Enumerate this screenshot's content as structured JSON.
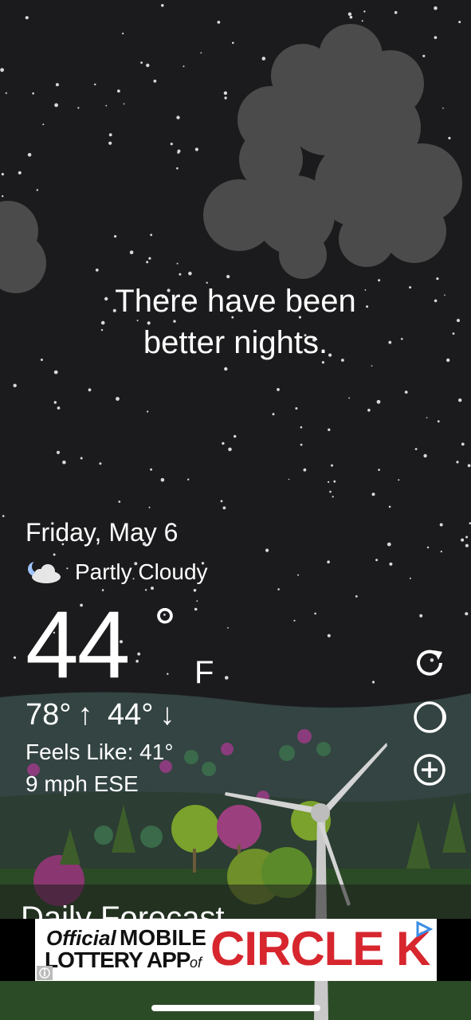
{
  "message": {
    "line1": "There have been",
    "line2": "better nights."
  },
  "weather": {
    "date": "Friday, May 6",
    "condition": "Partly Cloudy",
    "condition_icon": "partly-cloudy-night-icon",
    "temperature": "44",
    "degree_symbol": "°",
    "unit": "F",
    "high": "78°",
    "high_arrow": "↑",
    "low": "44°",
    "low_arrow": "↓",
    "feels_like": "Feels Like: 41°",
    "wind": "9 mph ESE"
  },
  "buttons": {
    "refresh_icon": "refresh-icon",
    "moon_icon": "moon-phase-icon",
    "add_icon": "add-location-icon"
  },
  "forecast": {
    "title": "Daily Forecast"
  },
  "ad": {
    "official": "Official",
    "mobile": "MOBILE",
    "lottery_app": "LOTTERY APP",
    "of": "of",
    "brand": "CIRCLE K",
    "info_icon": "ad-info-icon",
    "adchoices_icon": "adchoices-icon"
  },
  "colors": {
    "sky": "#1b1b1d",
    "cloud": "#4a4a4a",
    "hill": "#3a4a48",
    "grass": "#2f4a2c",
    "ad_brand": "#d7262e"
  }
}
